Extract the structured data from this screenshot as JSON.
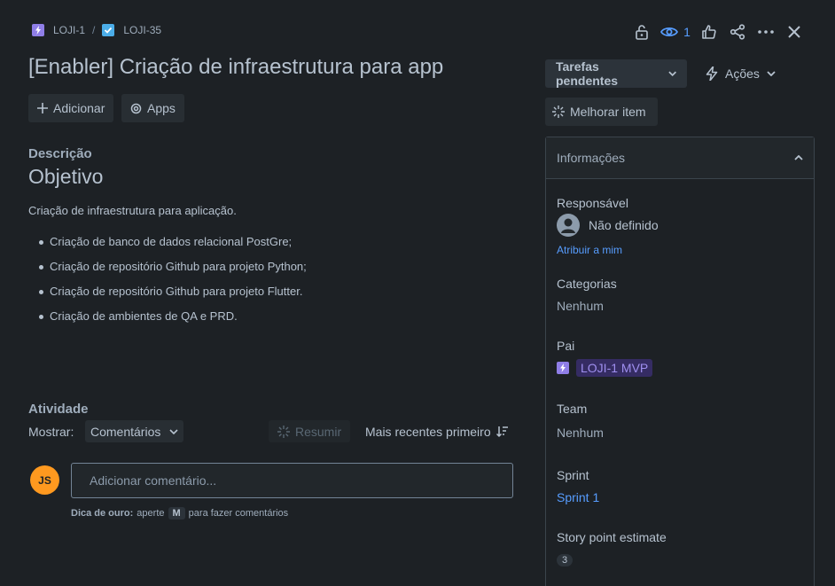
{
  "breadcrumb": {
    "items": [
      {
        "label": "LOJI-1",
        "icon": "epic-icon"
      },
      {
        "label": "LOJI-35",
        "icon": "task-checkbox-icon"
      }
    ],
    "separator": "/"
  },
  "header": {
    "watch_count": "1",
    "title": "[Enabler] Criação de infraestrutura para app",
    "add_label": "Adicionar",
    "apps_label": "Apps"
  },
  "description": {
    "label": "Descrição",
    "heading": "Objetivo",
    "paragraph": "Criação de infraestrutura para aplicação.",
    "bullets": [
      "Criação de banco de dados relacional PostGre;",
      "Criação de repositório Github para projeto Python;",
      "Criação de repositório Github para projeto Flutter.",
      "Criação de ambientes de QA e PRD."
    ]
  },
  "activity": {
    "label": "Atividade",
    "show_label": "Mostrar:",
    "filter_value": "Comentários",
    "summarize_label": "Resumir",
    "sort_label": "Mais recentes primeiro",
    "avatar_initials": "JS",
    "comment_placeholder": "Adicionar comentário...",
    "tip_bold": "Dica de ouro:",
    "tip_pre": "aperte",
    "tip_key": "M",
    "tip_post": "para fazer comentários"
  },
  "sidebar": {
    "status_label": "Tarefas pendentes",
    "actions_label": "Ações",
    "improve_label": "Melhorar item",
    "panel_title": "Informações",
    "fields": {
      "assignee_label": "Responsável",
      "assignee_value": "Não definido",
      "assign_me": "Atribuir a mim",
      "categories_label": "Categorias",
      "categories_value": "Nenhum",
      "parent_label": "Pai",
      "parent_value": "LOJI-1 MVP",
      "team_label": "Team",
      "team_value": "Nenhum",
      "sprint_label": "Sprint",
      "sprint_value": "Sprint 1",
      "story_points_label": "Story point estimate",
      "story_points_value": "3"
    }
  },
  "colors": {
    "background": "#1d2125",
    "accent_blue": "#579dff",
    "epic_purple": "#8f7ee7",
    "avatar_orange": "#ff991f"
  }
}
